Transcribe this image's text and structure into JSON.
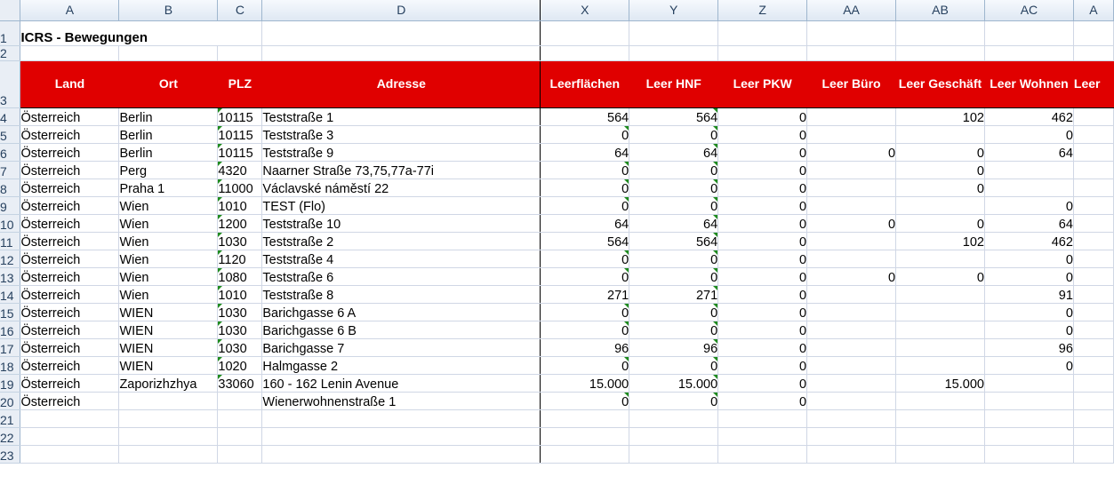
{
  "columns": [
    "A",
    "B",
    "C",
    "D",
    "X",
    "Y",
    "Z",
    "AA",
    "AB",
    "AC",
    "A"
  ],
  "row_numbers": [
    "1",
    "2",
    "3",
    "4",
    "5",
    "6",
    "7",
    "8",
    "9",
    "10",
    "11",
    "12",
    "13",
    "14",
    "15",
    "16",
    "17",
    "18",
    "19",
    "20",
    "21",
    "22",
    "23"
  ],
  "title": "ICRS - Bewegungen",
  "headers": [
    "Land",
    "Ort",
    "PLZ",
    "Adresse",
    "Leerflächen",
    "Leer HNF",
    "Leer PKW",
    "Leer Büro",
    "Leer Geschäft",
    "Leer Wohnen",
    "Leer"
  ],
  "rows": [
    [
      "Österreich",
      "Berlin",
      "10115",
      "Teststraße 1",
      "564",
      "564",
      "0",
      "",
      "102",
      "462"
    ],
    [
      "Österreich",
      "Berlin",
      "10115",
      "Teststraße 3",
      "0",
      "0",
      "0",
      "",
      "",
      "0"
    ],
    [
      "Österreich",
      "Berlin",
      "10115",
      "Teststraße 9",
      "64",
      "64",
      "0",
      "0",
      "0",
      "64"
    ],
    [
      "Österreich",
      "Perg",
      "4320",
      "Naarner Straße 73,75,77a-77i",
      "0",
      "0",
      "0",
      "",
      "0",
      ""
    ],
    [
      "Österreich",
      "Praha 1",
      "11000",
      "Václavské náměstí 22",
      "0",
      "0",
      "0",
      "",
      "0",
      ""
    ],
    [
      "Österreich",
      "Wien",
      "1010",
      "TEST (Flo)",
      "0",
      "0",
      "0",
      "",
      "",
      "0"
    ],
    [
      "Österreich",
      "Wien",
      "1200",
      "Teststraße 10",
      "64",
      "64",
      "0",
      "0",
      "0",
      "64"
    ],
    [
      "Österreich",
      "Wien",
      "1030",
      "Teststraße 2",
      "564",
      "564",
      "0",
      "",
      "102",
      "462"
    ],
    [
      "Österreich",
      "Wien",
      "1120",
      "Teststraße 4",
      "0",
      "0",
      "0",
      "",
      "",
      "0"
    ],
    [
      "Österreich",
      "Wien",
      "1080",
      "Teststraße 6",
      "0",
      "0",
      "0",
      "0",
      "0",
      "0"
    ],
    [
      "Österreich",
      "Wien",
      "1010",
      "Teststraße 8",
      "271",
      "271",
      "0",
      "",
      "",
      "91"
    ],
    [
      "Österreich",
      "WIEN",
      "1030",
      "Barichgasse 6 A",
      "0",
      "0",
      "0",
      "",
      "",
      "0"
    ],
    [
      "Österreich",
      "WIEN",
      "1030",
      "Barichgasse 6 B",
      "0",
      "0",
      "0",
      "",
      "",
      "0"
    ],
    [
      "Österreich",
      "WIEN",
      "1030",
      "Barichgasse 7",
      "96",
      "96",
      "0",
      "",
      "",
      "96"
    ],
    [
      "Österreich",
      "WIEN",
      "1020",
      "Halmgasse 2",
      "0",
      "0",
      "0",
      "",
      "",
      "0"
    ],
    [
      "Österreich",
      "Zaporizhzhya",
      "33060",
      "160 - 162 Lenin Avenue",
      "15.000",
      "15.000",
      "0",
      "",
      "15.000",
      ""
    ],
    [
      "Österreich",
      "",
      "",
      "Wienerwohnenstraße 1",
      "0",
      "0",
      "0",
      "",
      "",
      ""
    ]
  ]
}
